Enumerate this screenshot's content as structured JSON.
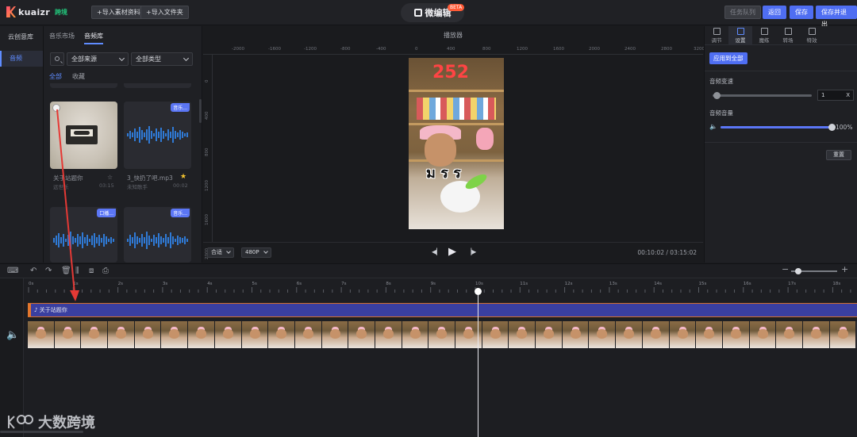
{
  "header": {
    "logo_text": "kuaizr",
    "logo_badge": "跨境",
    "import_material": "+导入素材资料",
    "import_folder": "+导入文件夹",
    "title": "微编辑",
    "title_badge": "BETA",
    "task_queue": "任务队列",
    "back": "返回",
    "save": "保存",
    "save_exit": "保存并退出"
  },
  "left_nav": {
    "heading": "云创意库",
    "items": [
      {
        "label": "音频"
      }
    ]
  },
  "library": {
    "tabs": [
      "音乐市场",
      "音频库"
    ],
    "source_select": "全部来源",
    "type_select": "全部类型",
    "filters": [
      "全部",
      "收藏"
    ],
    "cards": [
      {
        "name": "关于站题你",
        "sub": "远世乐",
        "duration": "03:15",
        "tag": "",
        "starred": false
      },
      {
        "name": "3_快扔了吧.mp3",
        "sub": "未知歌手",
        "duration": "00:02",
        "tag": "音乐...",
        "starred": true
      },
      {
        "name": "",
        "sub": "",
        "duration": "",
        "tag": "口播...",
        "starred": false
      },
      {
        "name": "",
        "sub": "",
        "duration": "",
        "tag": "音乐...",
        "starred": false
      }
    ]
  },
  "player": {
    "title": "播放器",
    "ruler_h": [
      "-2000",
      "-1600",
      "-1200",
      "-800",
      "-400",
      "0",
      "400",
      "800",
      "1200",
      "1600",
      "2000",
      "2400",
      "2800",
      "3200"
    ],
    "ruler_v": [
      "0",
      "400",
      "800",
      "1200",
      "1600",
      "2000"
    ],
    "video_overlay_number": "252",
    "video_overlay_text": "ม ร ร",
    "fit_select": "合适",
    "quality_select": "480P",
    "timecode": "00:10:02 / 03:15:02"
  },
  "right_panel": {
    "tabs": [
      "调节",
      "设置",
      "魔练",
      "转场",
      "特效"
    ],
    "active_tab": 1,
    "apply_all": "应用到全部",
    "speed_label": "音频变速",
    "speed_value": "1",
    "speed_unit": "X",
    "speed_level": 0.02,
    "volume_label": "音频音量",
    "volume_value": "100%",
    "volume_level": 1.0,
    "reset": "重置"
  },
  "timeline": {
    "ruler": [
      "0s",
      "1s",
      "2s",
      "3s",
      "4s",
      "5s",
      "6s",
      "7s",
      "8s",
      "9s",
      "10s",
      "11s",
      "12s",
      "13s",
      "14s",
      "15s",
      "16s",
      "17s",
      "18s"
    ],
    "audio_clip": "关于站题你",
    "frame_count": 31,
    "playhead": "10s",
    "watermark": "大数跨境",
    "zoom_level": 0.08
  },
  "colors": {
    "accent": "#4f6ef2",
    "annotation_arrow": "#e53935",
    "audio_clip": "#3a3fa0",
    "audio_clip_border": "#d4702c"
  }
}
